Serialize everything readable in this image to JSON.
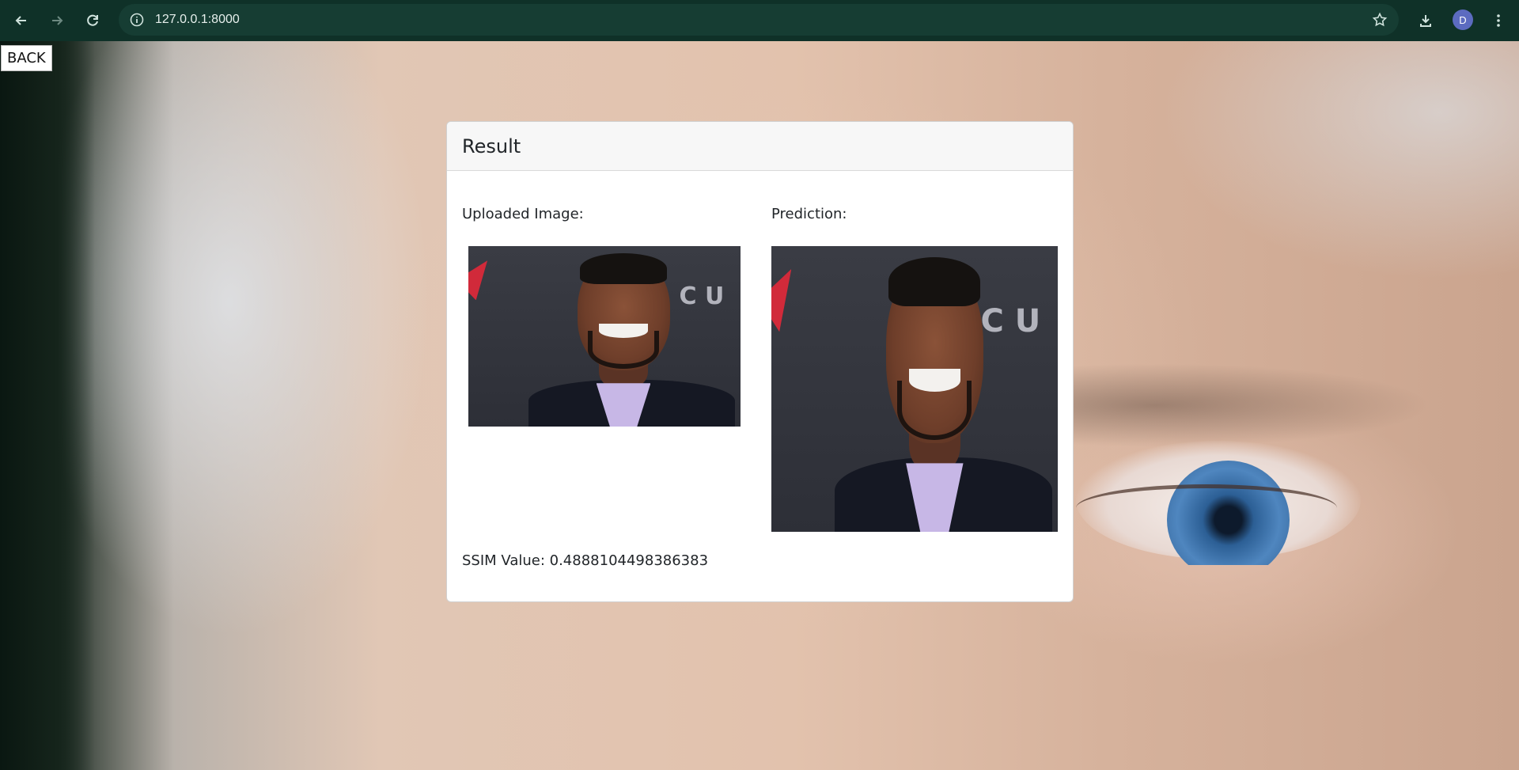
{
  "browser": {
    "url": "127.0.0.1:8000",
    "profile_initial": "D"
  },
  "page": {
    "back_label": "BACK"
  },
  "result": {
    "title": "Result",
    "uploaded_label": "Uploaded Image:",
    "prediction_label": "Prediction:",
    "ssim_text": "SSIM Value: 0.4888104498386383"
  }
}
